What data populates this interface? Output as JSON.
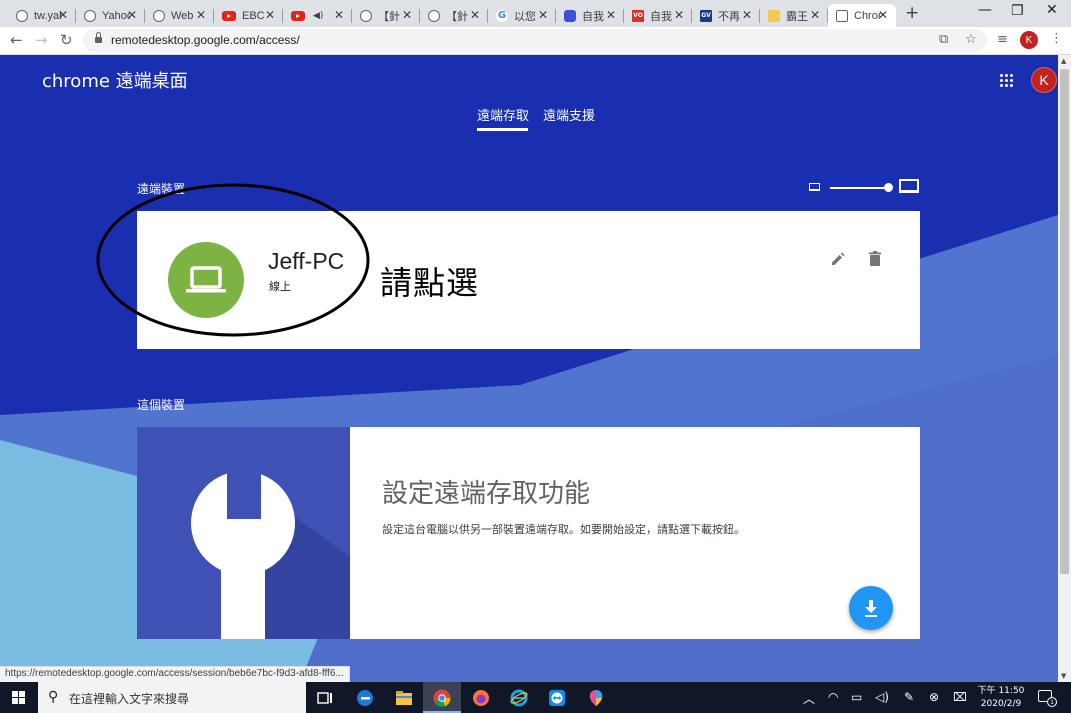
{
  "browser": {
    "tabs": [
      {
        "icon": "globe-icon",
        "title": "tw.yahoo"
      },
      {
        "icon": "globe-icon",
        "title": "Yahoo"
      },
      {
        "icon": "globe-icon",
        "title": "Web"
      },
      {
        "icon": "youtube-icon",
        "title": "EBC"
      },
      {
        "icon": "youtube-icon",
        "title": ""
      },
      {
        "icon": "globe-icon",
        "title": "【針"
      },
      {
        "icon": "globe-icon",
        "title": "【針"
      },
      {
        "icon": "google-icon",
        "title": "以您"
      },
      {
        "icon": "chat-icon",
        "title": "自我"
      },
      {
        "icon": "vo-icon",
        "title": "自我"
      },
      {
        "icon": "gv-icon",
        "title": "不再"
      },
      {
        "icon": "bookmark-icon",
        "title": "霸王"
      },
      {
        "icon": "remote-desktop-icon",
        "title": "Chrome"
      }
    ],
    "fav_text": {
      "vo": "VO",
      "gv": "GV",
      "g": "G"
    },
    "url": "remotedesktop.google.com/access/",
    "profile_initial": "K"
  },
  "page": {
    "app_title": "chrome 遠端桌面",
    "nav": {
      "access": "遠端存取",
      "support": "遠端支援"
    },
    "remote_devices_label": "遠端裝置",
    "device": {
      "name": "Jeff-PC",
      "status": "線上"
    },
    "annotation": "請點選",
    "this_device_label": "這個裝置",
    "setup": {
      "title": "設定遠端存取功能",
      "description": "設定這台電腦以供另一部裝置遠端存取。如要開始設定，請點選下載按鈕。"
    },
    "status_link": "https://remotedesktop.google.com/access/session/beb6e7bc-f9d3-afd8-fff6...",
    "profile_initial": "K"
  },
  "taskbar": {
    "search_placeholder": "在這裡輸入文字來搜尋",
    "time": "下午 11:50",
    "date": "2020/2/9",
    "notification_count": "1"
  }
}
